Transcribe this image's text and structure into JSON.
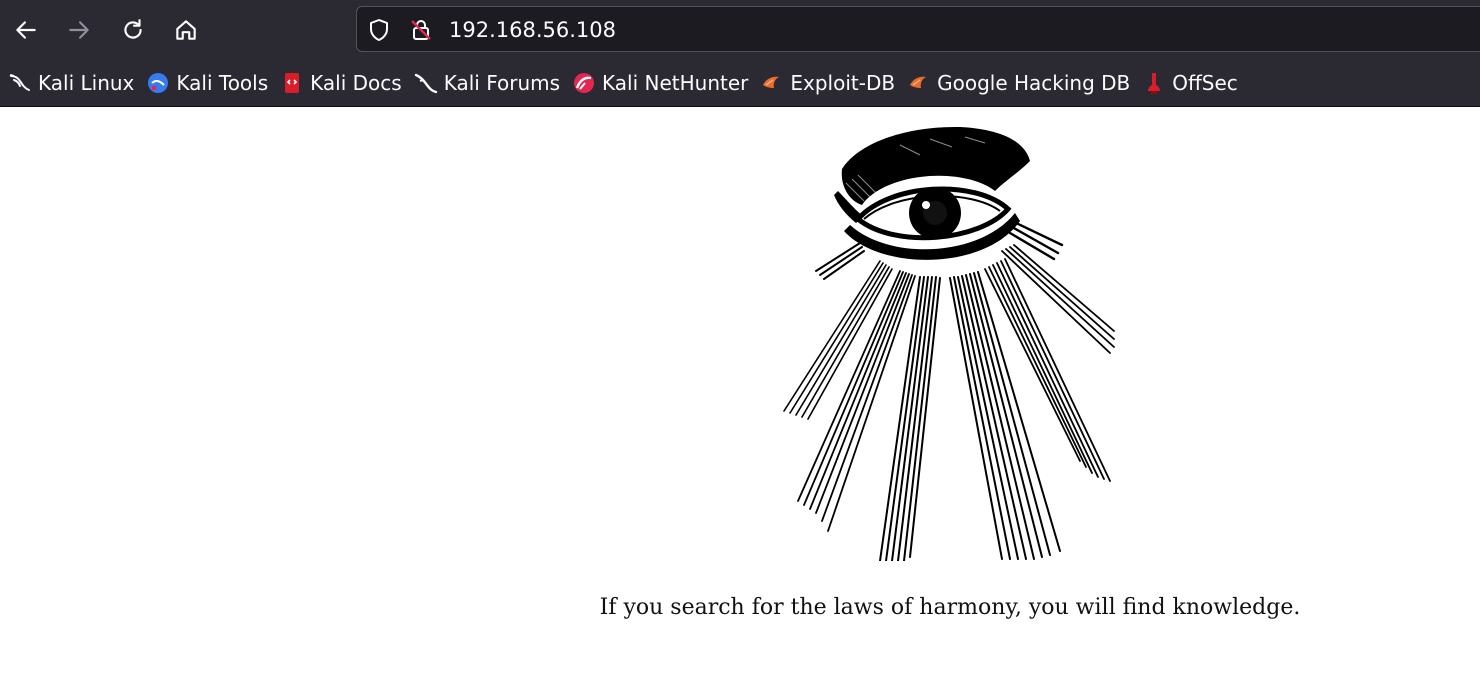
{
  "browser": {
    "url": "192.168.56.108",
    "bookmarks": [
      {
        "label": "Kali Linux",
        "icon": "kali-dragon-icon"
      },
      {
        "label": "Kali Tools",
        "icon": "kali-tools-icon"
      },
      {
        "label": "Kali Docs",
        "icon": "kali-docs-icon"
      },
      {
        "label": "Kali Forums",
        "icon": "kali-forums-icon"
      },
      {
        "label": "Kali NetHunter",
        "icon": "kali-nethunter-icon"
      },
      {
        "label": "Exploit-DB",
        "icon": "exploit-db-icon"
      },
      {
        "label": "Google Hacking DB",
        "icon": "ghdb-icon"
      },
      {
        "label": "OffSec",
        "icon": "offsec-icon"
      }
    ]
  },
  "page": {
    "caption": "If you search for the laws of harmony, you will find knowledge."
  },
  "colors": {
    "chrome_bg": "#2b2a33",
    "urlbar_bg": "#1c1b22",
    "text_light": "#fbfbfe",
    "page_bg": "#ffffff"
  }
}
